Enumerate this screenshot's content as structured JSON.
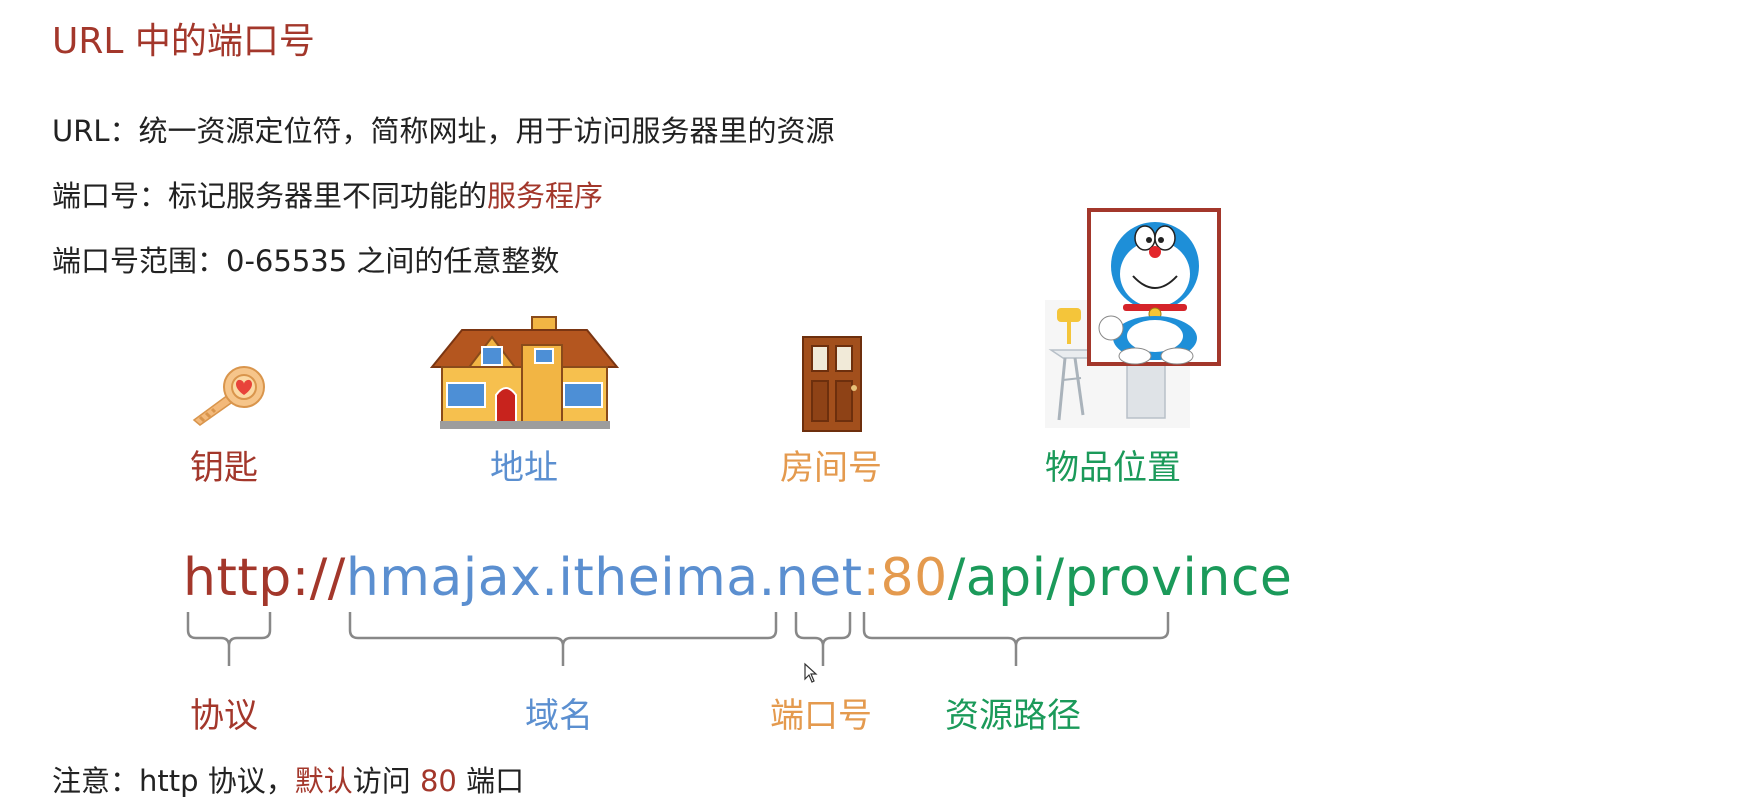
{
  "title": "URL 中的端口号",
  "lines": {
    "url_def": "URL：统一资源定位符，简称网址，用于访问服务器里的资源",
    "port_def_prefix": "端口号：标记服务器里不同功能的",
    "port_def_highlight": "服务程序",
    "port_range": "端口号范围：0-65535 之间的任意整数"
  },
  "analogy": {
    "key": "钥匙",
    "address": "地址",
    "room": "房间号",
    "item_location": "物品位置"
  },
  "url_parts": {
    "protocol": "http://",
    "domain": "hmajax.itheima.net",
    "port": ":80",
    "path": "/api/province"
  },
  "labels": {
    "protocol": "协议",
    "domain": "域名",
    "port": "端口号",
    "path": "资源路径"
  },
  "note": {
    "prefix": "注意：http 协议，",
    "highlight": "默认",
    "middle": "访问 ",
    "number": "80",
    "suffix": " 端口"
  },
  "colors": {
    "red": "#a3372b",
    "blue": "#5b8fd0",
    "orange": "#e49a4e",
    "green": "#1b9a5a"
  },
  "icons": [
    "key-icon",
    "house-icon",
    "door-icon",
    "desk-icon",
    "doraemon-image",
    "cursor-icon"
  ]
}
